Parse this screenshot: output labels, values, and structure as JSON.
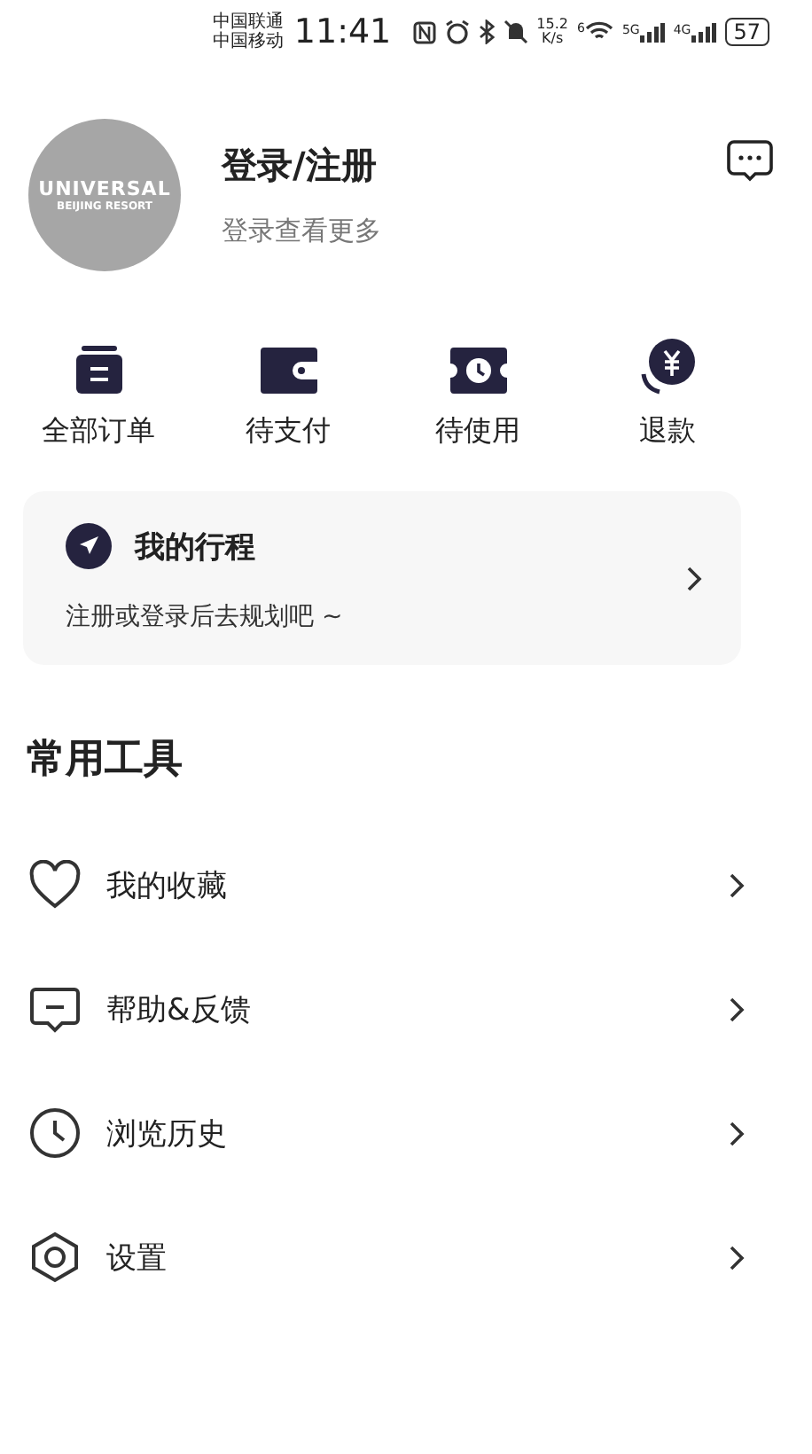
{
  "status_bar": {
    "carrier_1": "中国联通",
    "carrier_2": "中国移动",
    "time": "11:41",
    "speed_value": "15.2",
    "speed_unit": "K/s",
    "wifi_badge": "6",
    "network_1": "5G",
    "network_2": "4G",
    "battery": "57"
  },
  "profile": {
    "avatar_line_1": "UNIVERSAL",
    "avatar_line_2": "BEIJING RESORT",
    "title": "登录/注册",
    "subtitle": "登录查看更多"
  },
  "orders": [
    {
      "kind": "all",
      "label": "全部订单"
    },
    {
      "kind": "pay",
      "label": "待支付"
    },
    {
      "kind": "use",
      "label": "待使用"
    },
    {
      "kind": "refund",
      "label": "退款"
    }
  ],
  "trip_card": {
    "title": "我的行程",
    "subtitle": "注册或登录后去规划吧 ~"
  },
  "tools_title": "常用工具",
  "tools": [
    {
      "kind": "heart",
      "label": "我的收藏"
    },
    {
      "kind": "feedback",
      "label": "帮助&反馈"
    },
    {
      "kind": "clock",
      "label": "浏览历史"
    },
    {
      "kind": "settings",
      "label": "设置"
    }
  ]
}
